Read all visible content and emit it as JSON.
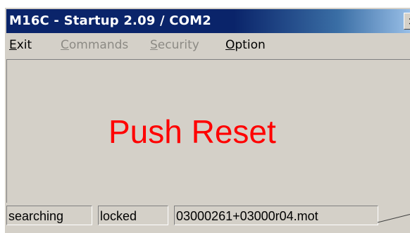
{
  "window": {
    "title": "M16C - Startup 2.09 / COM2",
    "close_glyph": "×"
  },
  "menu": {
    "items": [
      {
        "label": "Exit",
        "accel": "E",
        "rest": "xit",
        "enabled": true
      },
      {
        "label": "Commands",
        "accel": "C",
        "rest": "ommands",
        "enabled": false
      },
      {
        "label": "Security",
        "accel": "S",
        "rest": "ecurity",
        "enabled": false
      },
      {
        "label": "Option",
        "accel": "O",
        "rest": "ption",
        "enabled": true
      }
    ]
  },
  "main": {
    "message": "Push Reset",
    "message_color": "#ff0000"
  },
  "status": {
    "panels": [
      "searching",
      "locked",
      "03000261+03000r04.mot"
    ]
  },
  "colors": {
    "title_active": "#0a246a",
    "face": "#d4d0c8",
    "disabled_text": "#8c8a84"
  }
}
